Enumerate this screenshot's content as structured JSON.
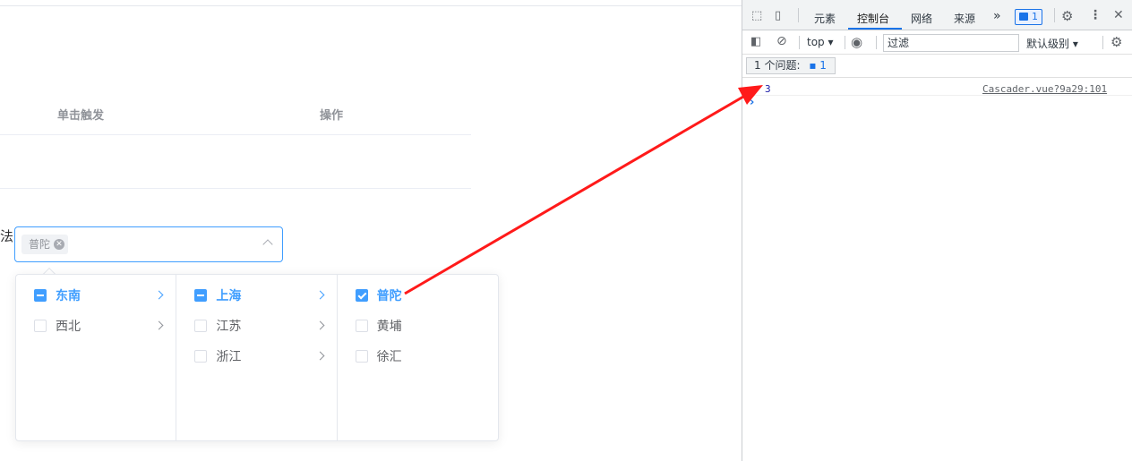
{
  "table": {
    "header_trigger": "单击触发",
    "header_action": "操作"
  },
  "form": {
    "label_fragment": "法",
    "selected_tag": "普陀"
  },
  "cascader": {
    "col1": [
      {
        "label": "东南",
        "state": "indeterminate"
      },
      {
        "label": "西北",
        "state": "unchecked"
      }
    ],
    "col2": [
      {
        "label": "上海",
        "state": "indeterminate"
      },
      {
        "label": "江苏",
        "state": "unchecked"
      },
      {
        "label": "浙江",
        "state": "unchecked"
      }
    ],
    "col3": [
      {
        "label": "普陀",
        "state": "checked"
      },
      {
        "label": "黄埔",
        "state": "unchecked"
      },
      {
        "label": "徐汇",
        "state": "unchecked"
      }
    ]
  },
  "devtools": {
    "tabs": [
      "元素",
      "控制台",
      "网络",
      "来源"
    ],
    "selected_tab": "控制台",
    "more": "»",
    "issue_badge_count": "1",
    "context": "top",
    "filter_placeholder": "过滤",
    "levels": "默认级别",
    "issues_label": "1 个问题:",
    "issues_count": "1",
    "log_value": "3",
    "log_source": "Cascader.vue?9a29:101",
    "prompt": "›"
  },
  "colors": {
    "accent": "#409eff",
    "devtools_accent": "#1a73e8",
    "annotation_arrow": "#ff1a1a"
  }
}
